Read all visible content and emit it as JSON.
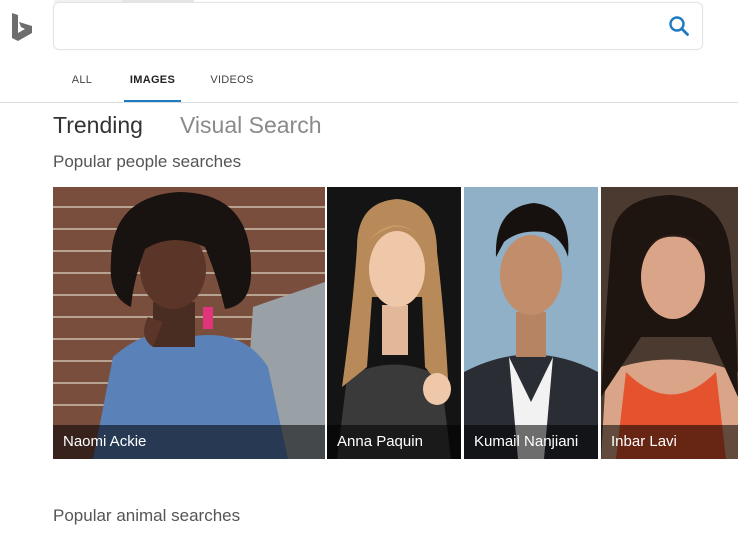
{
  "search": {
    "query": "",
    "placeholder": ""
  },
  "nav": {
    "items": [
      {
        "label": "ALL",
        "active": false
      },
      {
        "label": "IMAGES",
        "active": true
      },
      {
        "label": "VIDEOS",
        "active": false
      }
    ]
  },
  "section_tabs": [
    {
      "label": "Trending",
      "active": true
    },
    {
      "label": "Visual Search",
      "active": false
    }
  ],
  "popular_people": {
    "heading": "Popular people searches",
    "cards": [
      {
        "name": "Naomi Ackie"
      },
      {
        "name": "Anna Paquin"
      },
      {
        "name": "Kumail Nanjiani"
      },
      {
        "name": "Inbar Lavi"
      }
    ]
  },
  "popular_animals": {
    "heading": "Popular animal searches"
  },
  "colors": {
    "accent": "#1e7bc2",
    "logo": "#6d6d6d",
    "search_icon": "#1e7bc2",
    "caption_bg": "#000000"
  },
  "icons": {
    "logo": "bing-logo-icon",
    "search": "search-icon"
  }
}
